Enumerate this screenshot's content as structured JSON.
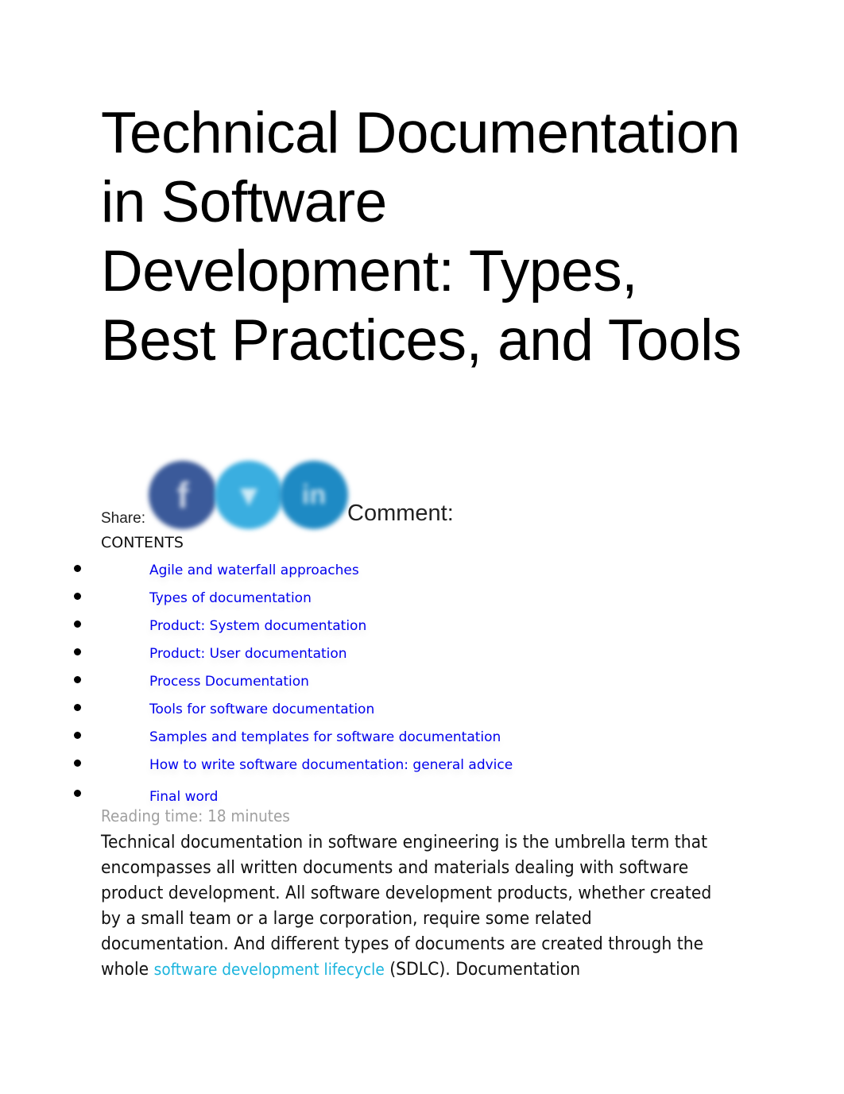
{
  "article": {
    "title": "Technical Documentation in Software Development: Types, Best Practices, and Tools"
  },
  "share": {
    "label": "Share:",
    "icons": [
      {
        "name": "facebook-icon",
        "glyph": "f",
        "color": "#3b5a9a"
      },
      {
        "name": "twitter-icon",
        "glyph": "🐦",
        "color": "#3aaee0"
      },
      {
        "name": "linkedin-icon",
        "glyph": "in",
        "color": "#1e8ac4"
      }
    ],
    "comment_label": "Comment:"
  },
  "contents": {
    "heading": "CONTENTS",
    "items": [
      {
        "label": "Agile and waterfall approaches"
      },
      {
        "label": "Types of documentation"
      },
      {
        "label": "Product: System documentation"
      },
      {
        "label": "Product: User documentation"
      },
      {
        "label": "Process Documentation"
      },
      {
        "label": "Tools for software documentation"
      },
      {
        "label": "Samples and templates for software documentation"
      },
      {
        "label": "How to write software documentation: general advice"
      },
      {
        "label": "Final word"
      }
    ]
  },
  "reading_time": "Reading time: 18 minutes",
  "intro": {
    "text_before_link": "Technical documentation in software engineering is the umbrella term that encompasses all written documents and materials dealing with software product development. All software development products, whether created by a small team or a large corporation, require some related documentation. And different types of documents are created through the whole ",
    "link_text": "software development lifecycle",
    "text_after_link": " (SDLC). Documentation"
  },
  "colors": {
    "link": "#0000ee",
    "inline_link": "#1bb4dd",
    "muted": "#a0a0a0"
  }
}
